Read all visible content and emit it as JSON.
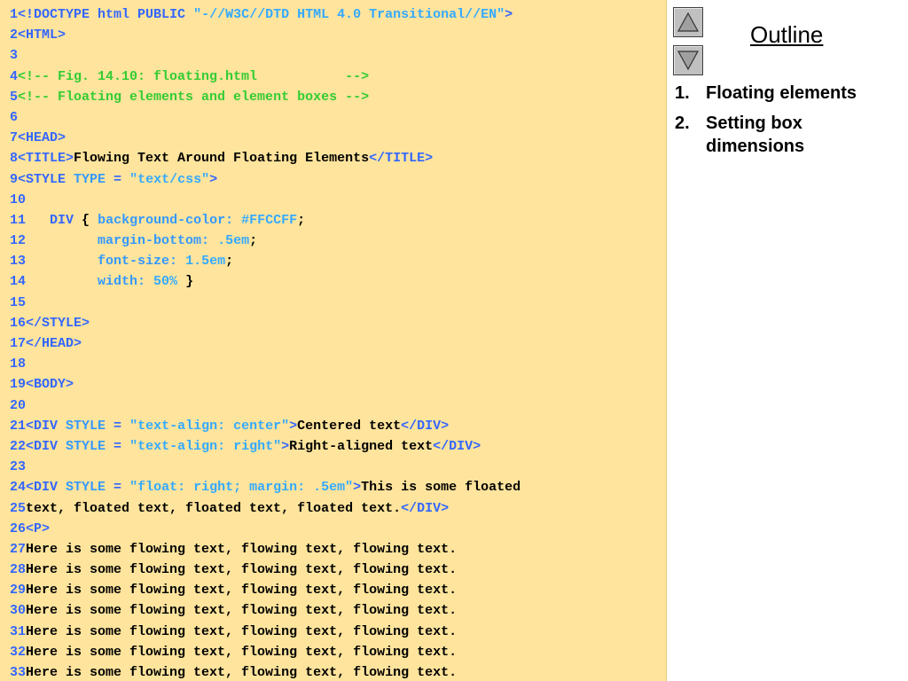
{
  "outline": {
    "title": "Outline",
    "items": [
      {
        "num": "1.",
        "label": "Floating elements"
      },
      {
        "num": "2.",
        "label": "Setting box dimensions"
      }
    ]
  },
  "nav": {
    "prev_icon": "triangle-up-icon",
    "next_icon": "triangle-down-icon"
  },
  "code_lines": [
    {
      "n": "1",
      "tokens": [
        {
          "t": "tag",
          "s": "<!DOCTYPE html PUBLIC "
        },
        {
          "t": "str",
          "s": "\"-//W3C//DTD HTML 4.0 Transitional//EN\""
        },
        {
          "t": "tag",
          "s": ">"
        }
      ]
    },
    {
      "n": "2",
      "tokens": [
        {
          "t": "tag",
          "s": "<HTML>"
        }
      ]
    },
    {
      "n": "3",
      "tokens": []
    },
    {
      "n": "4",
      "tokens": [
        {
          "t": "cmt",
          "s": "<!-- Fig. 14.10: floating.html           -->"
        }
      ]
    },
    {
      "n": "5",
      "tokens": [
        {
          "t": "cmt",
          "s": "<!-- Floating elements and element boxes -->"
        }
      ]
    },
    {
      "n": "6",
      "tokens": []
    },
    {
      "n": "7",
      "tokens": [
        {
          "t": "tag",
          "s": "<HEAD>"
        }
      ]
    },
    {
      "n": "8",
      "tokens": [
        {
          "t": "tag",
          "s": "<TITLE>"
        },
        {
          "t": "txt",
          "s": "Flowing Text Around Floating Elements"
        },
        {
          "t": "tag",
          "s": "</TITLE>"
        }
      ]
    },
    {
      "n": "9",
      "tokens": [
        {
          "t": "tag",
          "s": "<STYLE "
        },
        {
          "t": "attr",
          "s": "TYPE"
        },
        {
          "t": "tag",
          "s": " = "
        },
        {
          "t": "str",
          "s": "\"text/css\""
        },
        {
          "t": "tag",
          "s": ">"
        }
      ]
    },
    {
      "n": "10",
      "tokens": []
    },
    {
      "n": "11",
      "tokens": [
        {
          "t": "pun",
          "s": "   "
        },
        {
          "t": "sel",
          "s": "DIV"
        },
        {
          "t": "pun",
          "s": " { "
        },
        {
          "t": "prop",
          "s": "background-color: "
        },
        {
          "t": "val",
          "s": "#FFCCFF"
        },
        {
          "t": "pun",
          "s": ";"
        }
      ]
    },
    {
      "n": "12",
      "tokens": [
        {
          "t": "pun",
          "s": "         "
        },
        {
          "t": "prop",
          "s": "margin-bottom: "
        },
        {
          "t": "val",
          "s": ".5em"
        },
        {
          "t": "pun",
          "s": ";"
        }
      ]
    },
    {
      "n": "13",
      "tokens": [
        {
          "t": "pun",
          "s": "         "
        },
        {
          "t": "prop",
          "s": "font-size: "
        },
        {
          "t": "val",
          "s": "1.5em"
        },
        {
          "t": "pun",
          "s": ";"
        }
      ]
    },
    {
      "n": "14",
      "tokens": [
        {
          "t": "pun",
          "s": "         "
        },
        {
          "t": "prop",
          "s": "width: "
        },
        {
          "t": "val",
          "s": "50%"
        },
        {
          "t": "pun",
          "s": " }"
        }
      ]
    },
    {
      "n": "15",
      "tokens": []
    },
    {
      "n": "16",
      "tokens": [
        {
          "t": "tag",
          "s": "</STYLE>"
        }
      ]
    },
    {
      "n": "17",
      "tokens": [
        {
          "t": "tag",
          "s": "</HEAD>"
        }
      ]
    },
    {
      "n": "18",
      "tokens": []
    },
    {
      "n": "19",
      "tokens": [
        {
          "t": "tag",
          "s": "<BODY>"
        }
      ]
    },
    {
      "n": "20",
      "tokens": []
    },
    {
      "n": "21",
      "tokens": [
        {
          "t": "tag",
          "s": "<DIV "
        },
        {
          "t": "attr",
          "s": "STYLE"
        },
        {
          "t": "tag",
          "s": " = "
        },
        {
          "t": "str",
          "s": "\"text-align: center\""
        },
        {
          "t": "tag",
          "s": ">"
        },
        {
          "t": "txt",
          "s": "Centered text"
        },
        {
          "t": "tag",
          "s": "</DIV>"
        }
      ]
    },
    {
      "n": "22",
      "tokens": [
        {
          "t": "tag",
          "s": "<DIV "
        },
        {
          "t": "attr",
          "s": "STYLE"
        },
        {
          "t": "tag",
          "s": " = "
        },
        {
          "t": "str",
          "s": "\"text-align: right\""
        },
        {
          "t": "tag",
          "s": ">"
        },
        {
          "t": "txt",
          "s": "Right-aligned text"
        },
        {
          "t": "tag",
          "s": "</DIV>"
        }
      ]
    },
    {
      "n": "23",
      "tokens": []
    },
    {
      "n": "24",
      "tokens": [
        {
          "t": "tag",
          "s": "<DIV "
        },
        {
          "t": "attr",
          "s": "STYLE"
        },
        {
          "t": "tag",
          "s": " = "
        },
        {
          "t": "str",
          "s": "\"float: right; margin: .5em\""
        },
        {
          "t": "tag",
          "s": ">"
        },
        {
          "t": "txt",
          "s": "This is some floated"
        }
      ]
    },
    {
      "n": "25",
      "tokens": [
        {
          "t": "txt",
          "s": "text, floated text, floated text, floated text."
        },
        {
          "t": "tag",
          "s": "</DIV>"
        }
      ]
    },
    {
      "n": "26",
      "tokens": [
        {
          "t": "tag",
          "s": "<P>"
        }
      ]
    },
    {
      "n": "27",
      "tokens": [
        {
          "t": "txt",
          "s": "Here is some flowing text, flowing text, flowing text."
        }
      ]
    },
    {
      "n": "28",
      "tokens": [
        {
          "t": "txt",
          "s": "Here is some flowing text, flowing text, flowing text."
        }
      ]
    },
    {
      "n": "29",
      "tokens": [
        {
          "t": "txt",
          "s": "Here is some flowing text, flowing text, flowing text."
        }
      ]
    },
    {
      "n": "30",
      "tokens": [
        {
          "t": "txt",
          "s": "Here is some flowing text, flowing text, flowing text."
        }
      ]
    },
    {
      "n": "31",
      "tokens": [
        {
          "t": "txt",
          "s": "Here is some flowing text, flowing text, flowing text."
        }
      ]
    },
    {
      "n": "32",
      "tokens": [
        {
          "t": "txt",
          "s": "Here is some flowing text, flowing text, flowing text."
        }
      ]
    },
    {
      "n": "33",
      "tokens": [
        {
          "t": "txt",
          "s": "Here is some flowing text, flowing text, flowing text."
        }
      ]
    }
  ]
}
